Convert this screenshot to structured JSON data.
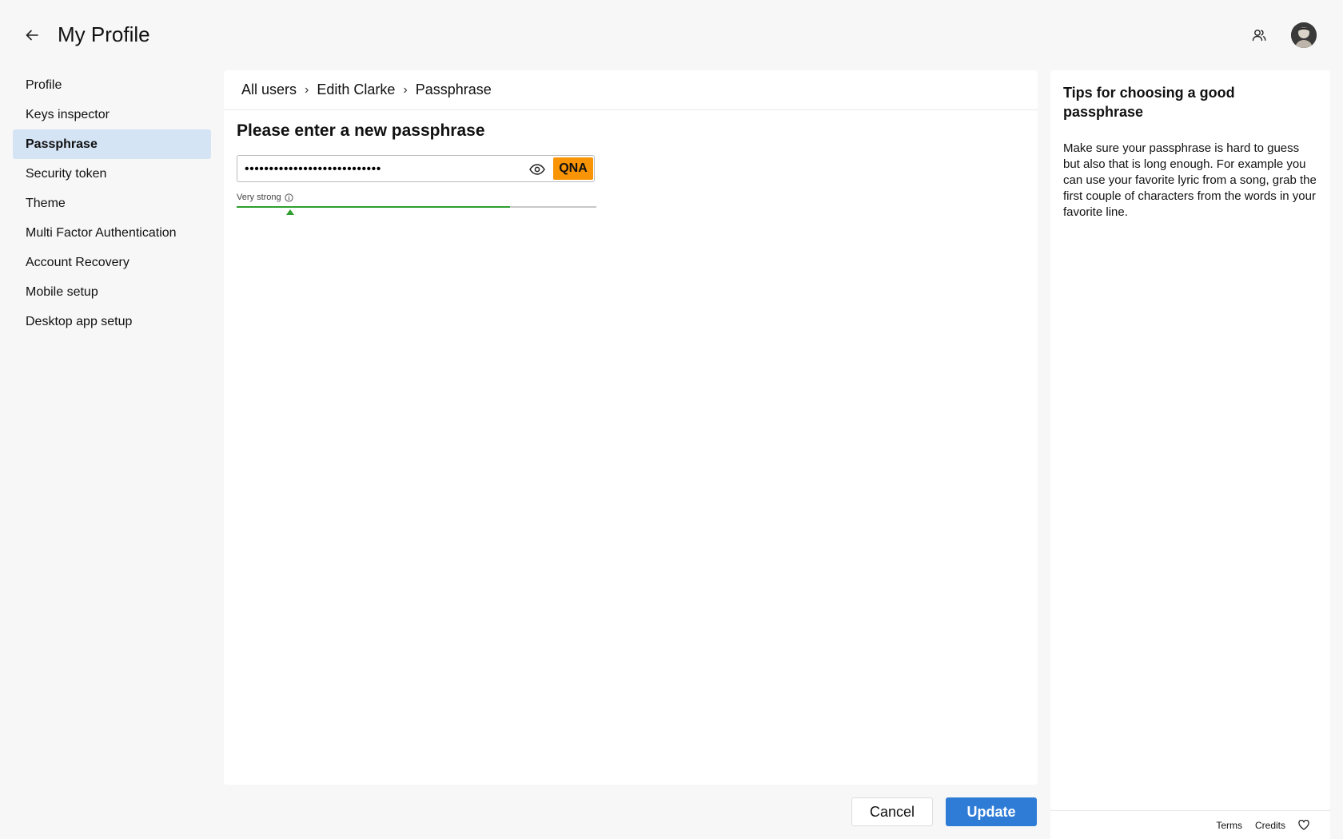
{
  "header": {
    "title": "My Profile",
    "back_icon": "arrow-left-icon",
    "users_icon": "users-icon",
    "avatar_alt": "user-avatar"
  },
  "sidebar": {
    "items": [
      {
        "label": "Profile",
        "active": false
      },
      {
        "label": "Keys inspector",
        "active": false
      },
      {
        "label": "Passphrase",
        "active": true
      },
      {
        "label": "Security token",
        "active": false
      },
      {
        "label": "Theme",
        "active": false
      },
      {
        "label": "Multi Factor Authentication",
        "active": false
      },
      {
        "label": "Account Recovery",
        "active": false
      },
      {
        "label": "Mobile setup",
        "active": false
      },
      {
        "label": "Desktop app setup",
        "active": false
      }
    ]
  },
  "breadcrumb": {
    "items": [
      "All users",
      "Edith Clarke",
      "Passphrase"
    ],
    "separator": "›"
  },
  "form": {
    "title": "Please enter a new passphrase",
    "passphrase_value": "••••••••••••••••••••••••••••",
    "security_token": "QNA",
    "security_token_color": "#f89406",
    "strength_label": "Very strong",
    "strength_fraction": 0.76,
    "strength_color": "#2e9e2e"
  },
  "actions": {
    "cancel_label": "Cancel",
    "update_label": "Update",
    "update_color": "#2f7cd6"
  },
  "tips": {
    "title": "Tips for choosing a good passphrase",
    "body": "Make sure your passphrase is hard to guess but also that is long enough. For example you can use your favorite lyric from a song, grab the first couple of characters from the words in your favorite line."
  },
  "footer": {
    "terms_label": "Terms",
    "credits_label": "Credits"
  },
  "colors": {
    "active_nav_bg": "#d4e4f5",
    "page_bg": "#f7f7f7"
  }
}
